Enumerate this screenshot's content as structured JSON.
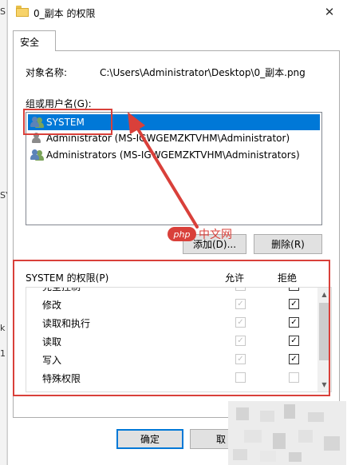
{
  "window": {
    "title": "0_副本 的权限",
    "close_glyph": "✕"
  },
  "background_fragments": [
    "S",
    "SY",
    "k",
    "1"
  ],
  "tabs": [
    {
      "label": "安全"
    }
  ],
  "object": {
    "label": "对象名称:",
    "value": "C:\\Users\\Administrator\\Desktop\\0_副本.png"
  },
  "groups": {
    "label": "组或用户名(G):",
    "items": [
      {
        "name": "SYSTEM",
        "icon": "users-group-icon",
        "selected": true
      },
      {
        "name": "Administrator (MS-IGWGEMZKTVHM\\Administrator)",
        "icon": "user-icon",
        "selected": false
      },
      {
        "name": "Administrators (MS-IGWGEMZKTVHM\\Administrators)",
        "icon": "users-group-icon",
        "selected": false
      }
    ]
  },
  "buttons": {
    "add": "添加(D)...",
    "remove": "删除(R)",
    "ok": "确定",
    "cancel": "取"
  },
  "permissions": {
    "title": "SYSTEM 的权限(P)",
    "allow_header": "允许",
    "deny_header": "拒绝",
    "check_glyph": "✓",
    "rows": [
      {
        "name": "完全控制",
        "allow": true,
        "deny": true
      },
      {
        "name": "修改",
        "allow": true,
        "deny": true
      },
      {
        "name": "读取和执行",
        "allow": true,
        "deny": true
      },
      {
        "name": "读取",
        "allow": true,
        "deny": true
      },
      {
        "name": "写入",
        "allow": true,
        "deny": true
      },
      {
        "name": "特殊权限",
        "allow": false,
        "deny": false
      }
    ]
  },
  "watermark": {
    "logo": "php",
    "text": "中文网"
  },
  "colors": {
    "accent": "#0078d7",
    "annotation": "#d9403a"
  }
}
